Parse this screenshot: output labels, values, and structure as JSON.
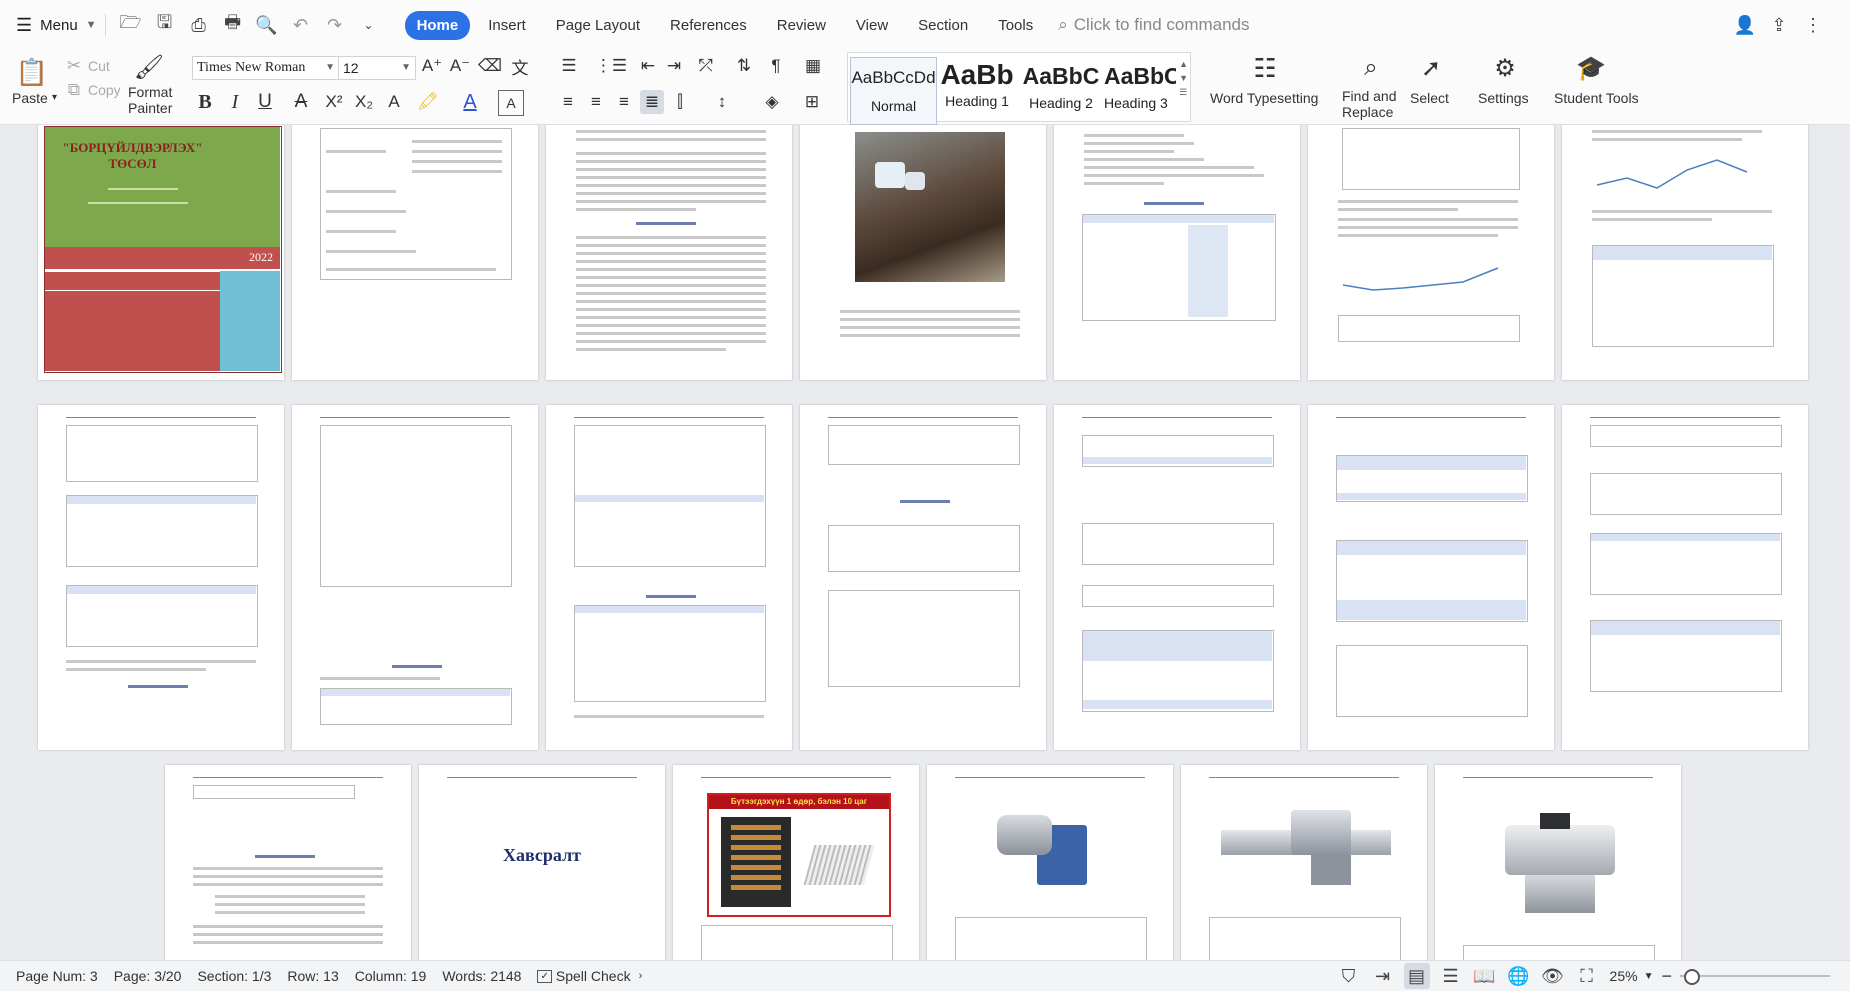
{
  "topbar": {
    "menu_label": "Menu",
    "tabs": [
      "Home",
      "Insert",
      "Page Layout",
      "References",
      "Review",
      "View",
      "Section",
      "Tools"
    ],
    "search_placeholder": "Click to find commands"
  },
  "ribbon": {
    "paste": "Paste",
    "cut": "Cut",
    "copy": "Copy",
    "format_painter_1": "Format",
    "format_painter_2": "Painter",
    "font_name": "Times New Roman",
    "font_size": "12",
    "styles": [
      {
        "preview": "AaBbCcDd",
        "label": "Normal"
      },
      {
        "preview": "AaBb",
        "label": "Heading 1"
      },
      {
        "preview": "AaBbC",
        "label": "Heading 2"
      },
      {
        "preview": "AaBbC",
        "label": "Heading 3"
      }
    ],
    "word_typesetting": "Word Typesetting",
    "find_replace_1": "Find and",
    "find_replace_2": "Replace",
    "select": "Select",
    "settings": "Settings",
    "student_tools": "Student Tools"
  },
  "document": {
    "cover_title_1": "\"БОРЦҮЙЛДВЭРЛЭХ\"",
    "cover_title_2": "ТӨСӨЛ",
    "cover_year": "2022",
    "appendix_title": "Хавсралт",
    "banner_text": "Бүтээгдэхүүн 1 өдөр, бэлэн 10 цаг"
  },
  "statusbar": {
    "page_num": "Page Num: 3",
    "page": "Page: 3/20",
    "section": "Section: 1/3",
    "row": "Row: 13",
    "column": "Column: 19",
    "words": "Words: 2148",
    "spell_check": "Spell Check",
    "zoom": "25%"
  },
  "colors": {
    "accent": "#2b73e4",
    "cover_green": "#7da84b",
    "cover_red": "#c0504d",
    "cover_blue": "#6fbfd6"
  }
}
